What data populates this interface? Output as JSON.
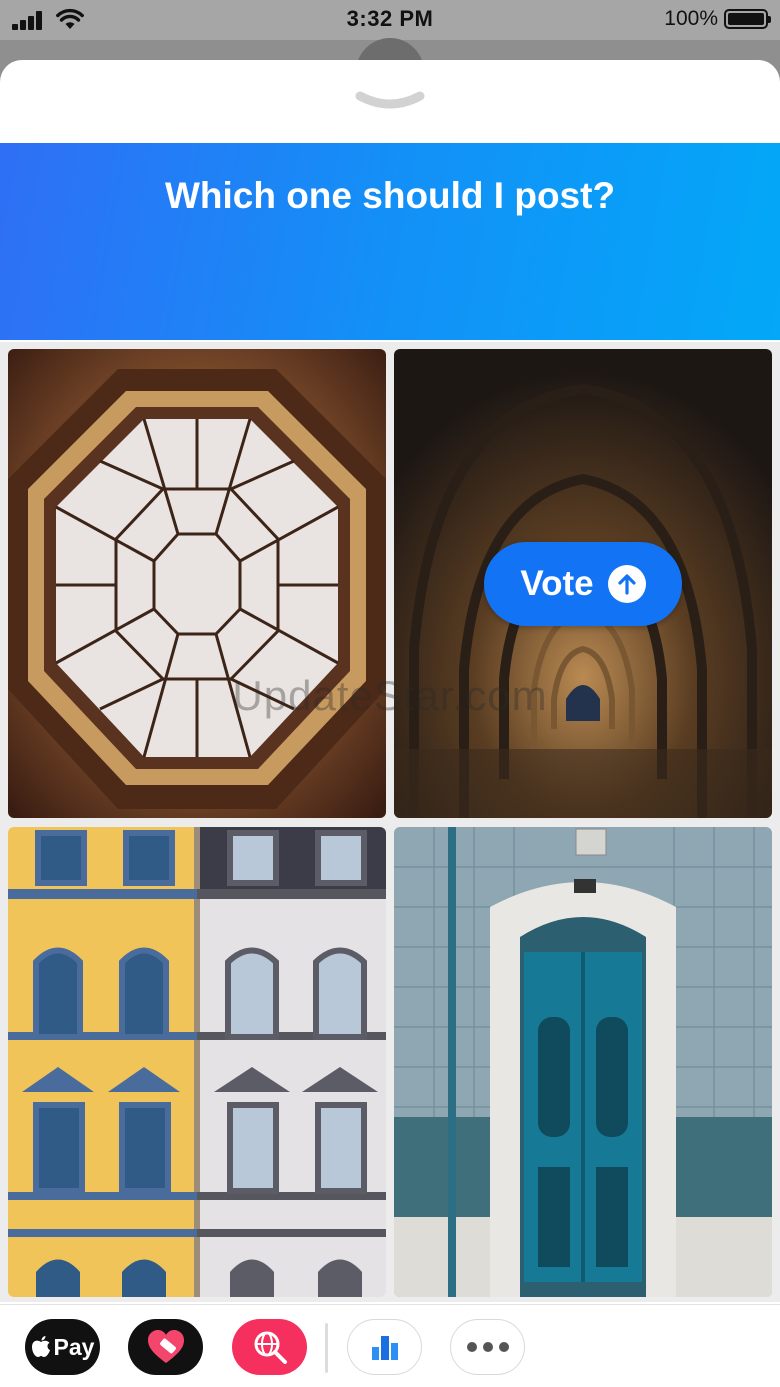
{
  "status_bar": {
    "time": "3:32 PM",
    "battery": "100%",
    "icons": [
      "signal-icon",
      "wifi-icon",
      "battery-icon"
    ]
  },
  "sheet": {
    "collapse_icon": "chevron-down-icon"
  },
  "poll": {
    "question": "Which one should I post?",
    "banner_colors": [
      "#2f6ff5",
      "#03a8f8"
    ],
    "options": [
      {
        "image": "octagonal-skylight-ceiling"
      },
      {
        "image": "vaulted-arch-corridor"
      },
      {
        "image": "yellow-and-white-building-facades"
      },
      {
        "image": "blue-door-tiled-wall"
      }
    ],
    "vote": {
      "label": "Vote",
      "icon": "arrow-up-circle-icon",
      "color": "#1274f5"
    }
  },
  "watermark": "UpdateStar.com",
  "app_drawer": {
    "apps": [
      {
        "name": "apple-pay",
        "label": "Pay",
        "icon": "apple-logo-icon"
      },
      {
        "name": "heart-sticker-app",
        "icon": "heart-icon"
      },
      {
        "name": "globe-search-app",
        "icon": "globe-search-icon"
      },
      {
        "name": "polls-app",
        "icon": "bar-chart-icon"
      },
      {
        "name": "more-apps",
        "icon": "more-dots-icon"
      }
    ]
  }
}
